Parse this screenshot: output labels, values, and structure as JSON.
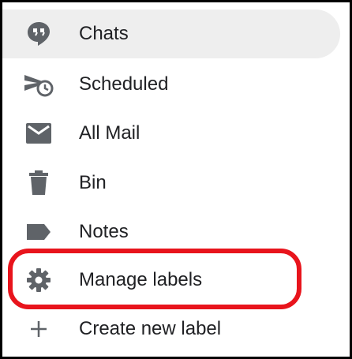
{
  "menu": {
    "items": [
      {
        "label": "Chats",
        "icon": "chat-bubble-icon",
        "active": true
      },
      {
        "label": "Scheduled",
        "icon": "scheduled-send-icon"
      },
      {
        "label": "All Mail",
        "icon": "mail-icon"
      },
      {
        "label": "Bin",
        "icon": "trash-icon"
      },
      {
        "label": "Notes",
        "icon": "label-tag-icon"
      },
      {
        "label": "Manage labels",
        "icon": "gear-icon",
        "highlighted": true
      },
      {
        "label": "Create new label",
        "icon": "plus-icon"
      }
    ]
  },
  "colors": {
    "icon": "#5f6368",
    "text": "#202124",
    "active_bg": "#eeeeee",
    "highlight_ring": "#e8141c"
  }
}
